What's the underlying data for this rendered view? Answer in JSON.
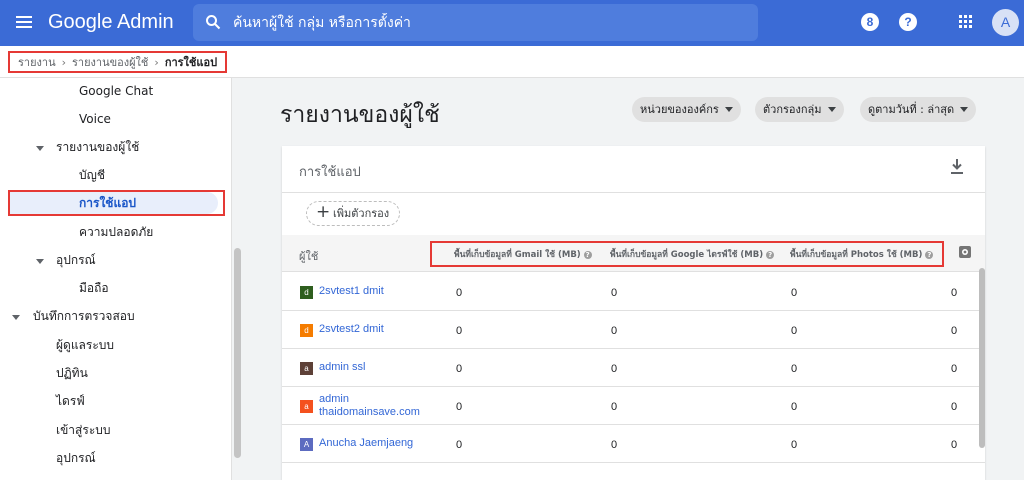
{
  "header": {
    "brand": "Google Admin",
    "search_placeholder": "ค้นหาผู้ใช้ กลุ่ม หรือการตั้งค่า",
    "notif_badge": "8",
    "help_label": "?",
    "avatar_initial": "A",
    "accent": "#3b6bd6"
  },
  "breadcrumb": {
    "items": [
      "รายงาน",
      "รายงานของผู้ใช้",
      "การใช้แอป"
    ],
    "separator": "›"
  },
  "sidebar": {
    "items": [
      {
        "label": "Google Chat"
      },
      {
        "label": "Voice"
      },
      {
        "label": "รายงานของผู้ใช้"
      },
      {
        "label": "บัญชี"
      },
      {
        "label": "การใช้แอป"
      },
      {
        "label": "ความปลอดภัย"
      },
      {
        "label": "อุปกรณ์"
      },
      {
        "label": "มือถือ"
      },
      {
        "label": "บันทึกการตรวจสอบ"
      },
      {
        "label": "ผู้ดูแลระบบ"
      },
      {
        "label": "ปฏิทิน"
      },
      {
        "label": "ไดรฟ์"
      },
      {
        "label": "เข้าสู่ระบบ"
      },
      {
        "label": "อุปกรณ์"
      }
    ]
  },
  "main": {
    "title": "รายงานของผู้ใช้",
    "chips": [
      "หน่วยขององค์กร",
      "ตัวกรองกลุ่ม",
      "ดูตามวันที่ : ล่าสุด"
    ],
    "card_title": "การใช้แอป",
    "add_filter": "เพิ่มตัวกรอง",
    "columns": {
      "user": "ผู้ใช้",
      "gmail": "พื้นที่เก็บข้อมูลที่ Gmail ใช้ (MB)",
      "drive": "พื้นที่เก็บข้อมูลที่ Google ไดรฟ์ใช้ (MB)",
      "photos": "พื้นที่เก็บข้อมูลที่ Photos ใช้ (MB)",
      "help": "?"
    },
    "rows": [
      {
        "initial": "d",
        "color": "#2e5e1e",
        "name": "2svtest1 dmit",
        "name2": "",
        "gmail": "0",
        "drive": "0",
        "photos": "0",
        "total": "0"
      },
      {
        "initial": "d",
        "color": "#f57c00",
        "name": "2svtest2 dmit",
        "name2": "",
        "gmail": "0",
        "drive": "0",
        "photos": "0",
        "total": "0"
      },
      {
        "initial": "a",
        "color": "#5d4037",
        "name": "admin ssl",
        "name2": "",
        "gmail": "0",
        "drive": "0",
        "photos": "0",
        "total": "0"
      },
      {
        "initial": "a",
        "color": "#f4511e",
        "name": "admin",
        "name2": "thaidomainsave.com",
        "gmail": "0",
        "drive": "0",
        "photos": "0",
        "total": "0"
      },
      {
        "initial": "A",
        "color": "#5c6bc0",
        "name": "Anucha Jaemjaeng",
        "name2": "",
        "gmail": "0",
        "drive": "0",
        "photos": "0",
        "total": "0"
      }
    ]
  }
}
